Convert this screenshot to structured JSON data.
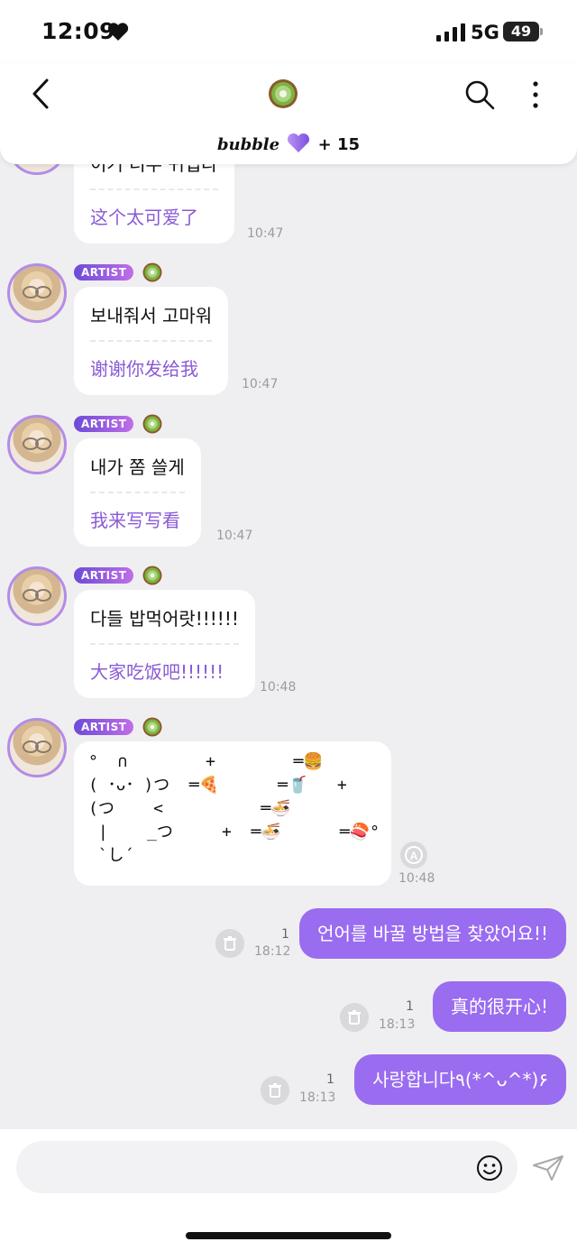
{
  "status_bar": {
    "time": "12:09",
    "network": "5G",
    "battery": "49"
  },
  "header": {
    "brand": "bubble",
    "plus": "+ 15"
  },
  "messages": [
    {
      "ko": "이거 너무 귀엽다",
      "zh": "这个太可爱了",
      "time": "10:47"
    },
    {
      "badge": "ARTIST",
      "ko": "보내줘서 고마워",
      "zh": "谢谢你发给我",
      "time": "10:47"
    },
    {
      "badge": "ARTIST",
      "ko": "내가 쫌 쓸게",
      "zh": "我来写写看",
      "time": "10:47"
    },
    {
      "badge": "ARTIST",
      "ko": "다들 밥먹어랏!!!!!!",
      "zh": "大家吃饭吧!!!!!!",
      "time": "10:48"
    },
    {
      "badge": "ARTIST",
      "time": "10:48"
    }
  ],
  "ascii_art": "°  ∩        +        ═🍔\n( ･ᴗ･ )つ  ═🍕      ═🥤   +\n(つ    <          ═🍜\n |    _つ     +  ═🍜      ═🍣°\n `し´",
  "my_messages": [
    {
      "text": "언어를 바꿀 방법을 찾았어요!!",
      "unread": "1",
      "time": "18:12"
    },
    {
      "text": "真的很开心!",
      "unread": "1",
      "time": "18:13"
    },
    {
      "text": "사랑합니다٩(*^ᴗ^*)۶",
      "unread": "1",
      "time": "18:13"
    }
  ],
  "colors": {
    "accent": "#9a6cf0",
    "translation": "#8a5ad6",
    "background": "#efeff1"
  }
}
